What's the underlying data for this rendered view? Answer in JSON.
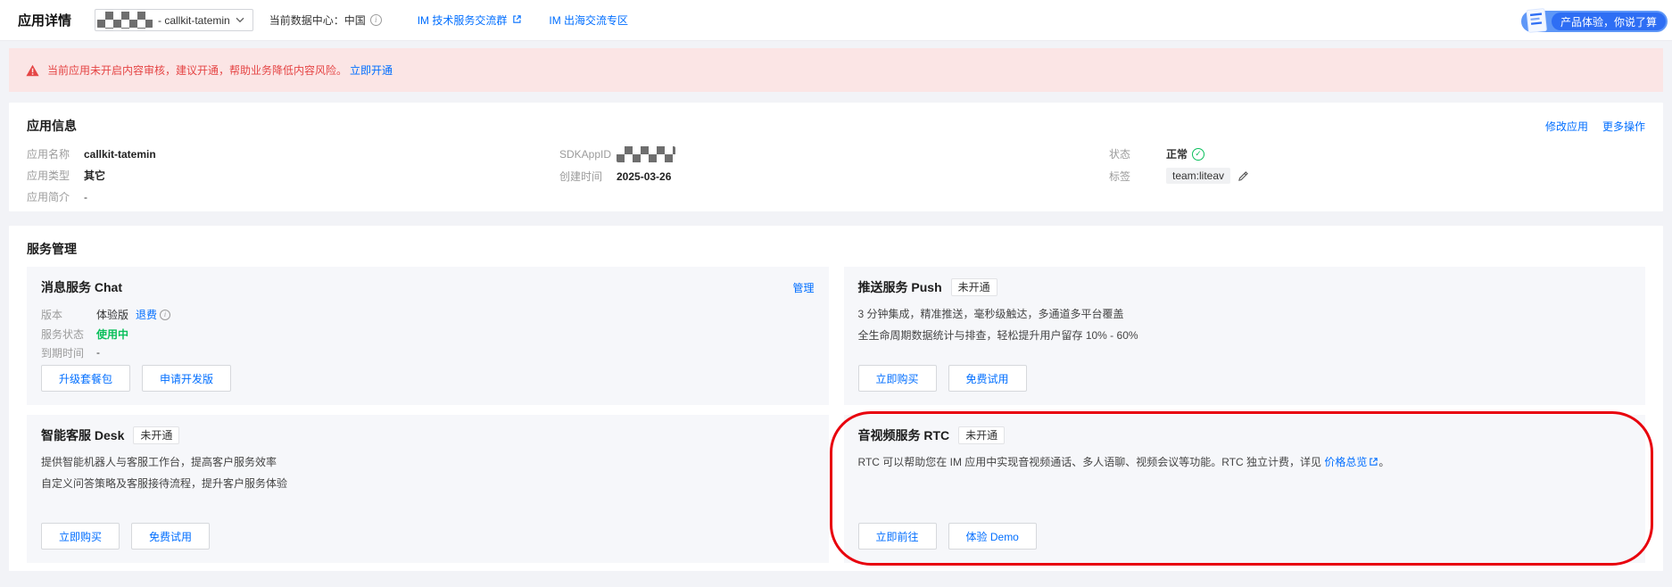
{
  "header": {
    "page_title": "应用详情",
    "app_selector_label": "- callkit-tatemin",
    "datacenter_label": "当前数据中心：中国",
    "community_link": "IM 技术服务交流群",
    "overseas_link": "IM 出海交流专区",
    "feedback_button": "产品体验，你说了算"
  },
  "alert": {
    "message": "当前应用未开启内容审核，建议开通，帮助业务降低内容风险。",
    "action_link": "立即开通"
  },
  "app_info": {
    "section_title": "应用信息",
    "modify_link": "修改应用",
    "more_actions_link": "更多操作",
    "name_label": "应用名称",
    "name_value": "callkit-tatemin",
    "type_label": "应用类型",
    "type_value": "其它",
    "intro_label": "应用简介",
    "intro_value": "-",
    "sdkappid_label": "SDKAppID",
    "created_label": "创建时间",
    "created_value": "2025-03-26",
    "status_label": "状态",
    "status_value": "正常",
    "tag_label": "标签",
    "tag_value": "team:liteav"
  },
  "services": {
    "section_title": "服务管理",
    "chat": {
      "title": "消息服务 Chat",
      "manage_link": "管理",
      "version_label": "版本",
      "version_value": "体验版",
      "refund_link": "退费",
      "status_label": "服务状态",
      "status_value": "使用中",
      "expire_label": "到期时间",
      "expire_value": "-",
      "upgrade_button": "升级套餐包",
      "apply_dev_button": "申请开发版"
    },
    "push": {
      "title": "推送服务 Push",
      "badge": "未开通",
      "desc_line1": "3 分钟集成，精准推送，毫秒级触达，多通道多平台覆盖",
      "desc_line2": "全生命周期数据统计与排查，轻松提升用户留存 10% - 60%",
      "buy_button": "立即购买",
      "trial_button": "免费试用"
    },
    "desk": {
      "title": "智能客服 Desk",
      "badge": "未开通",
      "desc_line1": "提供智能机器人与客服工作台，提高客户服务效率",
      "desc_line2": "自定义问答策略及客服接待流程，提升客户服务体验",
      "buy_button": "立即购买",
      "trial_button": "免费试用"
    },
    "rtc": {
      "title": "音视频服务 RTC",
      "badge": "未开通",
      "desc_prefix": "RTC 可以帮助您在 IM 应用中实现音视频通话、多人语聊、视频会议等功能。RTC 独立计费，详见 ",
      "pricing_link": "价格总览",
      "desc_suffix": "。",
      "go_button": "立即前往",
      "demo_button": "体验 Demo"
    }
  },
  "icons": {
    "check_glyph": "✓",
    "info_glyph": "i",
    "warning_name": "warning-triangle",
    "masked_name": "masked-value"
  },
  "colors": {
    "accent_blue": "#006eff",
    "success_green": "#0abf5b",
    "warning_red": "#e54545",
    "alert_bg": "#fbe5e5",
    "annotation_red": "#e8000d",
    "subcard_bg": "#f6f7fa",
    "page_bg": "#f2f3f7"
  }
}
